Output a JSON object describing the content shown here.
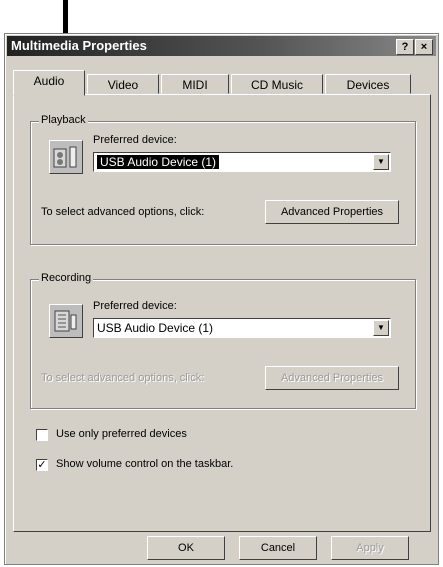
{
  "window": {
    "title": "Multimedia Properties",
    "help_glyph": "?",
    "close_glyph": "×"
  },
  "tabs": [
    {
      "label": "Audio"
    },
    {
      "label": "Video"
    },
    {
      "label": "MIDI"
    },
    {
      "label": "CD Music"
    },
    {
      "label": "Devices"
    }
  ],
  "playback": {
    "group_label": "Playback",
    "preferred_label": "Preferred device:",
    "device_value": "USB Audio Device (1)",
    "advanced_text": "To select advanced options, click:",
    "advanced_button": "Advanced Properties"
  },
  "recording": {
    "group_label": "Recording",
    "preferred_label": "Preferred device:",
    "device_value": "USB Audio Device (1)",
    "advanced_text": "To select advanced options, click:",
    "advanced_button": "Advanced Properties"
  },
  "options": {
    "use_preferred_label": "Use only preferred devices",
    "use_preferred_checked": false,
    "show_volume_label": "Show volume control on the taskbar.",
    "show_volume_checked": true,
    "check_mark": "✓"
  },
  "footer": {
    "ok": "OK",
    "cancel": "Cancel",
    "apply": "Apply"
  },
  "dropdown_glyph": "▼"
}
